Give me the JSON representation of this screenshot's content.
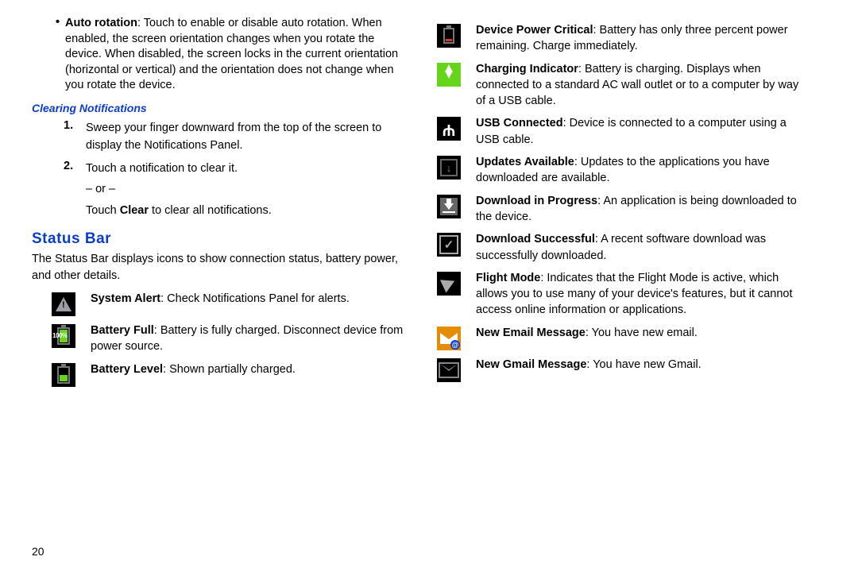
{
  "page_number": "20",
  "left": {
    "auto_rotation_label": "Auto rotation",
    "auto_rotation_desc": ": Touch to enable or disable auto rotation. When enabled, the screen orientation changes when you rotate the device. When disabled, the screen locks in the current orientation (horizontal or vertical) and the orientation does not change when you rotate the device.",
    "clearing_heading": "Clearing Notifications",
    "step1": "Sweep your finger downward from the top of the screen to display the Notifications Panel.",
    "step2a": "Touch a notification to clear it.",
    "step2_or": "– or –",
    "step2b_pre": "Touch ",
    "step2b_bold": "Clear",
    "step2b_post": " to clear all notifications.",
    "status_bar_heading": "Status Bar",
    "status_bar_para": "The Status Bar displays icons to show connection status, battery power, and other details.",
    "icons": [
      {
        "title": "System Alert",
        "desc": ": Check Notifications Panel for alerts."
      },
      {
        "title": "Battery Full",
        "desc": ": Battery is fully charged. Disconnect device from power source."
      },
      {
        "title": "Battery Level",
        "desc": ": Shown partially charged."
      }
    ],
    "batt100": "100%"
  },
  "right": {
    "icons": [
      {
        "title": "Device Power Critical",
        "desc": ": Battery has only three percent power remaining. Charge immediately."
      },
      {
        "title": "Charging Indicator",
        "desc": ": Battery is charging. Displays when connected to a standard AC wall outlet or to a computer by way of a USB cable."
      },
      {
        "title": "USB Connected",
        "desc": ": Device is connected to a computer using a USB cable."
      },
      {
        "title": "Updates Available",
        "desc": ": Updates to the applications you have downloaded are available."
      },
      {
        "title": "Download in Progress",
        "desc": ": An application is being downloaded to the device."
      },
      {
        "title": "Download Successful",
        "desc": ": A recent software download was successfully downloaded."
      },
      {
        "title": "Flight Mode",
        "desc": ": Indicates that the Flight Mode is active, which allows you to use many of your device's features, but it cannot access online information or applications."
      },
      {
        "title": "New Email Message",
        "desc": ": You have new email."
      },
      {
        "title": "New Gmail Message",
        "desc": ": You have new Gmail."
      }
    ]
  }
}
